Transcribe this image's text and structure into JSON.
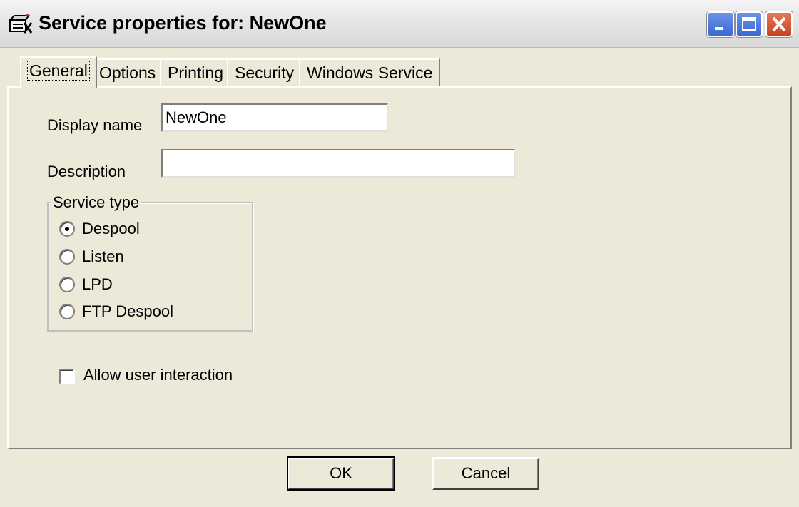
{
  "window": {
    "title": "Service properties for: NewOne",
    "icon": "service-icon"
  },
  "tabs": [
    {
      "label": "General",
      "active": true
    },
    {
      "label": "Options",
      "active": false
    },
    {
      "label": "Printing",
      "active": false
    },
    {
      "label": "Security",
      "active": false
    },
    {
      "label": "Windows Service",
      "active": false
    }
  ],
  "general": {
    "display_name_label": "Display name",
    "display_name_value": "NewOne",
    "description_label": "Description",
    "description_value": "",
    "service_type": {
      "legend": "Service type",
      "options": [
        {
          "label": "Despool",
          "selected": true
        },
        {
          "label": "Listen",
          "selected": false
        },
        {
          "label": "LPD",
          "selected": false
        },
        {
          "label": "FTP Despool",
          "selected": false
        }
      ]
    },
    "allow_interaction": {
      "label": "Allow user interaction",
      "checked": false
    }
  },
  "buttons": {
    "ok": "OK",
    "cancel": "Cancel"
  }
}
